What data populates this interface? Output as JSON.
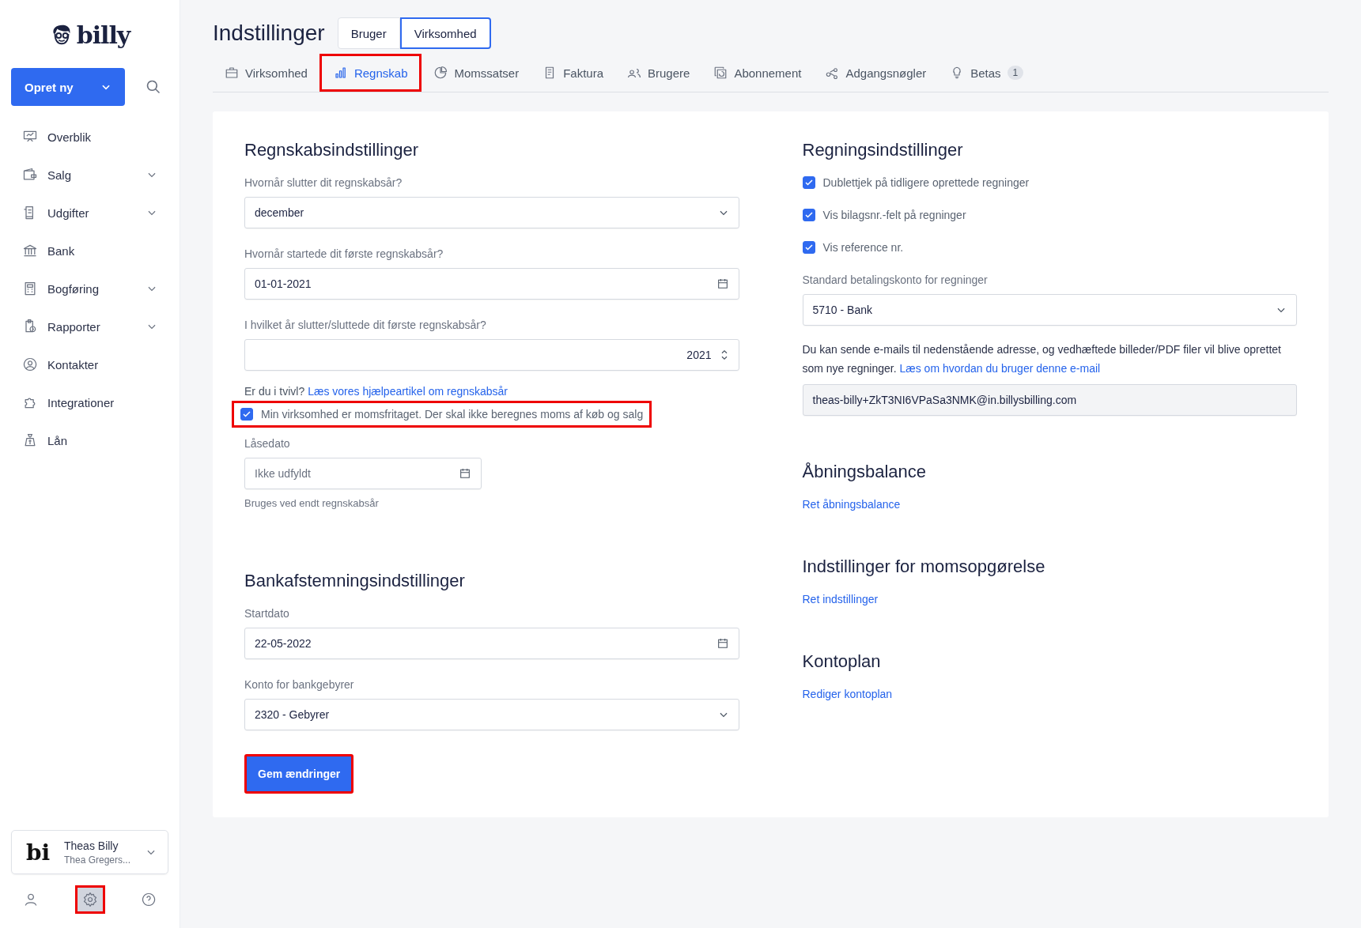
{
  "sidebar": {
    "logo": "billy",
    "create_button": "Opret ny",
    "items": [
      {
        "label": "Overblik",
        "expandable": false
      },
      {
        "label": "Salg",
        "expandable": true
      },
      {
        "label": "Udgifter",
        "expandable": true
      },
      {
        "label": "Bank",
        "expandable": false
      },
      {
        "label": "Bogføring",
        "expandable": true
      },
      {
        "label": "Rapporter",
        "expandable": true
      },
      {
        "label": "Kontakter",
        "expandable": false
      },
      {
        "label": "Integrationer",
        "expandable": false
      },
      {
        "label": "Lån",
        "expandable": false
      }
    ],
    "account": {
      "logo": "bi",
      "name": "Theas Billy",
      "subtitle": "Thea Gregers..."
    },
    "bottom_icons": [
      {
        "selected": false,
        "highlighted": false
      },
      {
        "selected": true,
        "highlighted": true
      },
      {
        "selected": false,
        "highlighted": false
      }
    ]
  },
  "header": {
    "title": "Indstillinger",
    "segments": [
      {
        "label": "Bruger",
        "selected": false
      },
      {
        "label": "Virksomhed",
        "selected": true
      }
    ]
  },
  "tabs": [
    {
      "label": "Virksomhed",
      "selected": false,
      "highlighted": false
    },
    {
      "label": "Regnskab",
      "selected": true,
      "highlighted": true
    },
    {
      "label": "Momssatser",
      "selected": false,
      "highlighted": false
    },
    {
      "label": "Faktura",
      "selected": false,
      "highlighted": false
    },
    {
      "label": "Brugere",
      "selected": false,
      "highlighted": false
    },
    {
      "label": "Abonnement",
      "selected": false,
      "highlighted": false
    },
    {
      "label": "Adgangsnøgler",
      "selected": false,
      "highlighted": false
    },
    {
      "label": "Betas",
      "selected": false,
      "highlighted": false,
      "badge": "1"
    }
  ],
  "accounting": {
    "title": "Regnskabsindstillinger",
    "fields": [
      {
        "kind": "select",
        "label": "Hvornår slutter dit regnskabsår?",
        "value": "december"
      },
      {
        "kind": "date",
        "label": "Hvornår startede dit første regnskabsår?",
        "value": "01-01-2021"
      },
      {
        "kind": "number",
        "label": "I hvilket år slutter/sluttede dit første regnskabsår?",
        "value": "2021"
      }
    ],
    "help": {
      "text": "Er du i tvivl?",
      "link": "Læs vores hjælpeartikel om regnskabsår"
    },
    "vat_exempt": {
      "label": "Min virksomhed er momsfritaget. Der skal ikke beregnes moms af køb og salg",
      "checked": true,
      "highlighted": true
    },
    "lock_date": {
      "label": "Låsedato",
      "placeholder": "Ikke udfyldt",
      "hint": "Bruges ved endt regnskabsår"
    }
  },
  "bank": {
    "title": "Bankafstemningsindstillinger",
    "fields": [
      {
        "kind": "date",
        "label": "Startdato",
        "value": "22-05-2022"
      },
      {
        "kind": "select",
        "label": "Konto for bankgebyrer",
        "value": "2320 - Gebyrer"
      }
    ]
  },
  "save_button": {
    "label": "Gem ændringer",
    "highlighted": true
  },
  "bills": {
    "title": "Regningsindstillinger",
    "options": [
      {
        "label": "Dublettjek på tidligere oprettede regninger",
        "checked": true
      },
      {
        "label": "Vis bilagsnr.-felt på regninger",
        "checked": true
      },
      {
        "label": "Vis reference nr.",
        "checked": true
      }
    ],
    "account": {
      "label": "Standard betalingskonto for regninger",
      "value": "5710 - Bank"
    },
    "email_info": {
      "text": "Du kan sende e-mails til nedenstående adresse, og vedhæftede billeder/PDF filer vil blive oprettet som nye regninger.",
      "link": "Læs om hvordan du bruger denne e-mail"
    },
    "email": "theas-billy+ZkT3NI6VPaSa3NMK@in.billysbilling.com"
  },
  "link_sections": [
    {
      "title": "Åbningsbalance",
      "link": "Ret åbningsbalance"
    },
    {
      "title": "Indstillinger for momsopgørelse",
      "link": "Ret indstillinger"
    },
    {
      "title": "Kontoplan",
      "link": "Rediger kontoplan"
    }
  ]
}
